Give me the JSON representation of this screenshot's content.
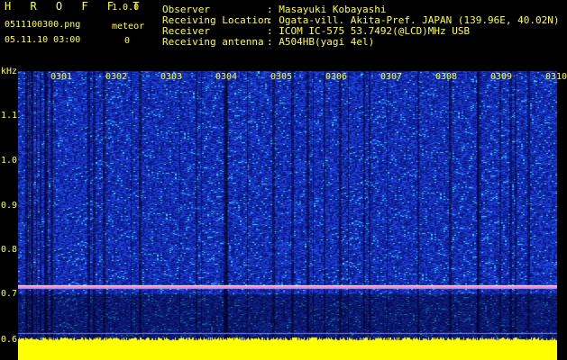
{
  "header": {
    "app_title": "H R O F F T",
    "app_version": "1.0.0",
    "file_name": "0511100300.png",
    "date_time": "05.11.10 03:00",
    "meteor_label": "meteor",
    "meteor_count": "0"
  },
  "info": [
    {
      "label": "Observer",
      "value": ": Masayuki Kobayashi"
    },
    {
      "label": "Receiving Location",
      "value": ": Ogata-vill. Akita-Pref. JAPAN (139.96E, 40.02N)"
    },
    {
      "label": "Receiver",
      "value": ": ICOM IC-575 53.7492(@LCD)MHz USB"
    },
    {
      "label": "Receiving antenna",
      "value": ": A504HB(yagi 4el)"
    }
  ],
  "spectrogram": {
    "unit": "kHz",
    "freq_ticks": [
      "1.1",
      "1.0",
      "0.9",
      "0.8",
      "0.7",
      "0.6"
    ],
    "time_labels": [
      "0301",
      "0302",
      "0303",
      "0304",
      "0305",
      "0306",
      "0307",
      "0308",
      "0309",
      "0310"
    ],
    "carrier_freq_khz": 0.72,
    "colors": {
      "background": "#0a1a8a",
      "noise_low": "#1a33c8",
      "noise_high": "#2fd6ff",
      "carrier": "#ff80c0",
      "signal_band": "#ffff00",
      "text": "#ffff3c"
    }
  }
}
